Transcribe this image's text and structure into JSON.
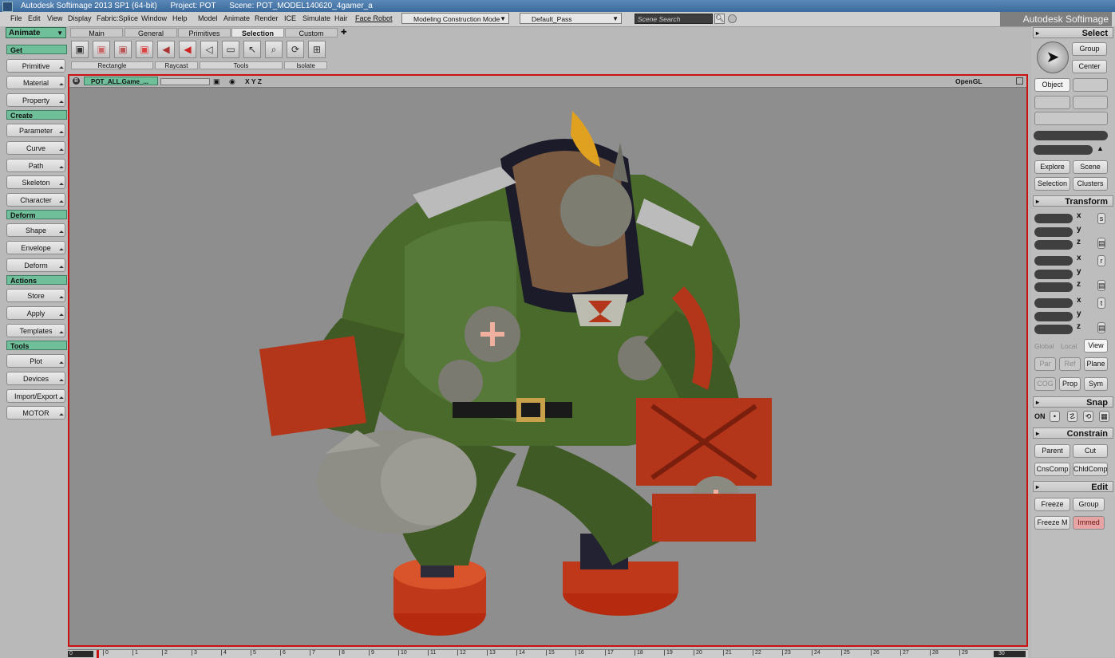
{
  "window": {
    "title": "Autodesk Softimage 2013 SP1 (64-bit)",
    "project": "Project: POT",
    "scene": "Scene: POT_MODEL140620_4gamer_a",
    "brand": "Autodesk Softimage"
  },
  "menubar": {
    "items": [
      "File",
      "Edit",
      "View",
      "Display",
      "Fabric:Splice",
      "Window",
      "Help",
      "Model",
      "Animate",
      "Render",
      "ICE",
      "Simulate",
      "Hair",
      "Face Robot"
    ],
    "mode": "Modeling Construction Mode",
    "pass": "Default_Pass",
    "search_placeholder": "Scene Search"
  },
  "left_panel": {
    "module": "Animate",
    "get": "Get",
    "get_items": [
      "Primitive",
      "Material",
      "Property"
    ],
    "create": "Create",
    "create_items": [
      "Parameter",
      "Curve",
      "Path",
      "Skeleton",
      "Character"
    ],
    "deform": "Deform",
    "deform_items": [
      "Shape",
      "Envelope",
      "Deform"
    ],
    "actions": "Actions",
    "actions_items": [
      "Store",
      "Apply",
      "Templates"
    ],
    "tools": "Tools",
    "tools_items": [
      "Plot",
      "Devices",
      "Import/Export",
      "MOTOR"
    ]
  },
  "tabs": [
    "Main",
    "General",
    "Primitives",
    "Selection",
    "Custom"
  ],
  "active_tab": "Selection",
  "toolbar_groups": [
    "Rectangle",
    "Raycast",
    "Tools",
    "Isolate"
  ],
  "viewport": {
    "camera": "POT_ALL.Game_...",
    "axes": "X Y Z",
    "display_mode": "OpenGL",
    "b_label": "B"
  },
  "timeline": {
    "start": "0",
    "ticks": [
      "0",
      "1",
      "2",
      "3",
      "4",
      "5",
      "6",
      "7",
      "8",
      "9",
      "10",
      "11",
      "12",
      "13",
      "14",
      "15",
      "16",
      "17",
      "18",
      "19",
      "20",
      "21",
      "22",
      "23",
      "24",
      "25",
      "26",
      "27",
      "28",
      "29"
    ],
    "end": "30"
  },
  "right_panel": {
    "select": "Select",
    "group": "Group",
    "center": "Center",
    "object": "Object",
    "explore": "Explore",
    "scene": "Scene",
    "selection": "Selection",
    "clusters": "Clusters",
    "transform": "Transform",
    "axes": [
      "x",
      "y",
      "z"
    ],
    "srt": [
      "s",
      "r",
      "t"
    ],
    "global": "Global",
    "local": "Local",
    "view": "View",
    "par": "Par",
    "ref": "Ref",
    "plane": "Plane",
    "cog": "COG",
    "prop": "Prop",
    "sym": "Sym",
    "snap": "Snap",
    "on": "ON",
    "constrain": "Constrain",
    "parent": "Parent",
    "cut": "Cut",
    "cnscomp": "CnsComp",
    "chldcomp": "ChldComp",
    "edit": "Edit",
    "freeze": "Freeze",
    "edit_group": "Group",
    "freeze_m": "Freeze M",
    "immed": "Immed"
  },
  "colors": {
    "section": "#6fbf9a",
    "viewport_border": "#cc1111",
    "viewport_bg": "#8e8e8e",
    "immed": "#e7a4a4"
  }
}
